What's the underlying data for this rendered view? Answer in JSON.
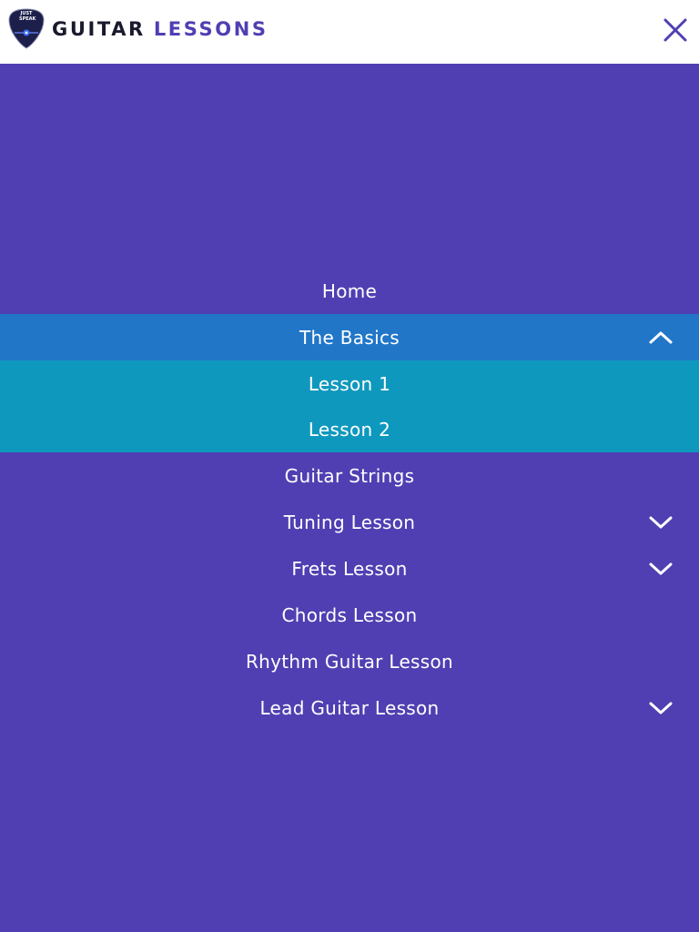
{
  "brand": {
    "logo_text_line1": "JUST",
    "logo_text_line2": "SPEAK",
    "title_part1": "GUITAR",
    "title_part2": "LESSONS"
  },
  "header": {
    "close_icon": "close-icon"
  },
  "colors": {
    "background": "#4f3fb2",
    "header_bg": "#ffffff",
    "active_item_bg": "#2176c8",
    "submenu_bg": "#0f98bd",
    "brand_dark": "#1a1a2e",
    "brand_accent": "#4f3fb2"
  },
  "nav": {
    "items": [
      {
        "label": "Home"
      },
      {
        "label": "The Basics",
        "expanded": true,
        "icon": "chevron-up-icon"
      },
      {
        "label": "Guitar Strings"
      },
      {
        "label": "Tuning Lesson",
        "icon": "chevron-down-icon"
      },
      {
        "label": "Frets Lesson",
        "icon": "chevron-down-icon"
      },
      {
        "label": "Chords Lesson"
      },
      {
        "label": "Rhythm Guitar Lesson"
      },
      {
        "label": "Lead Guitar Lesson",
        "icon": "chevron-down-icon"
      }
    ],
    "basics_submenu": [
      {
        "label": "Lesson 1"
      },
      {
        "label": "Lesson 2"
      }
    ]
  }
}
